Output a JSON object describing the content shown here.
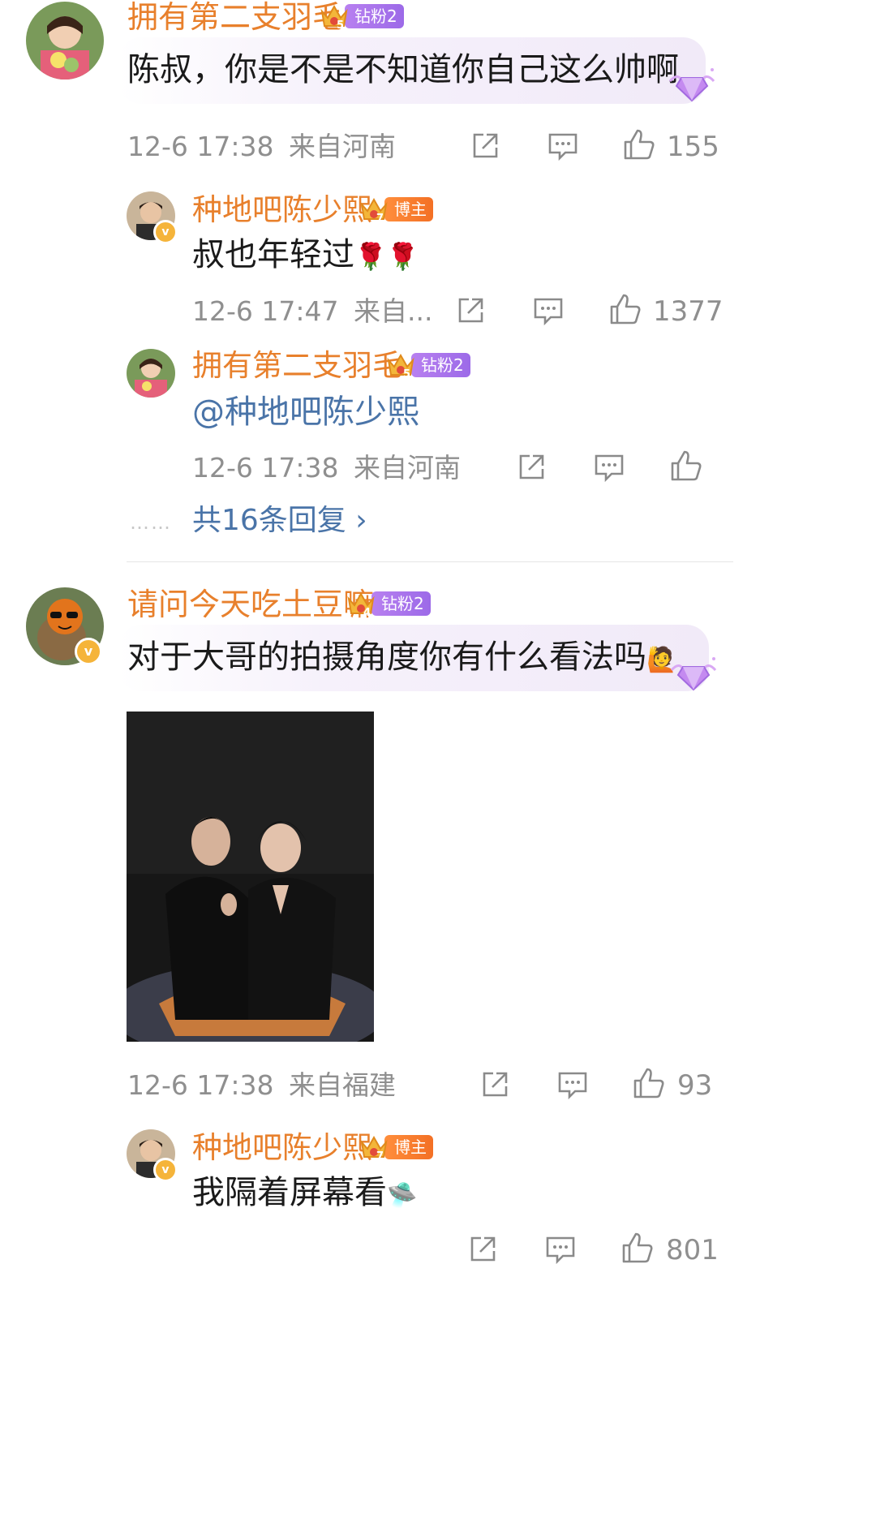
{
  "comments": [
    {
      "user": "拥有第二支羽毛",
      "badge_level": "5",
      "badge_label": "钻粉2",
      "text": "陈叔，你是不是不知道你自己这么帅啊",
      "time": "12-6 17:38",
      "location": "来自河南",
      "likes": "155",
      "replies": [
        {
          "user": "种地吧陈少熙",
          "badge_level": "7",
          "badge_label": "博主",
          "text": "叔也年轻过",
          "emoji": "🌹🌹",
          "time": "12-6 17:47",
          "location": "来自...",
          "likes": "1377"
        },
        {
          "user": "拥有第二支羽毛",
          "badge_level": "5",
          "badge_label": "钻粉2",
          "mention": "@种地吧陈少熙",
          "time": "12-6 17:38",
          "location": "来自河南",
          "likes": ""
        }
      ],
      "more_dots": "……",
      "more_replies": "共16条回复 ›"
    },
    {
      "user": "请问今天吃土豆嘛",
      "badge_level": "4",
      "badge_label": "钻粉2",
      "text": "对于大哥的拍摄角度你有什么看法吗",
      "emoji": "🙋",
      "time": "12-6 17:38",
      "location": "来自福建",
      "likes": "93",
      "replies": [
        {
          "user": "种地吧陈少熙",
          "badge_level": "7",
          "badge_label": "博主",
          "text": "我隔着屏幕看",
          "emoji": "🛸",
          "time": "",
          "location": "",
          "likes": "801"
        }
      ]
    }
  ],
  "colors": {
    "username": "#e8802c",
    "link": "#4a74a8",
    "meta": "#8f8f8f",
    "fan_badge": "#a574ec",
    "blogger_badge": "#f37025"
  }
}
